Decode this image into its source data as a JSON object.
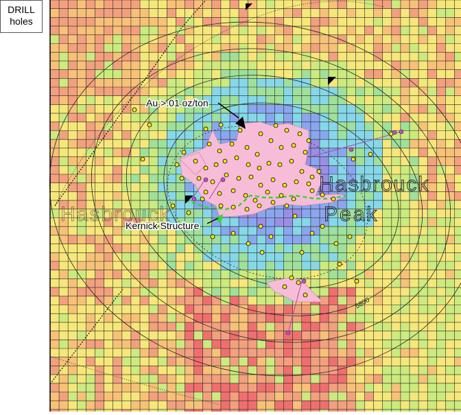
{
  "legend": {
    "line1": "DRILL",
    "line2": "holes"
  },
  "labels": {
    "au_threshold": "Au >.01 oz/ton",
    "kernick": "Kernick Structure",
    "place_name_1": "Hasbrouck",
    "place_name_2": "Peak",
    "place_name_left": "Hasbrouck",
    "contour": "5800"
  },
  "colors": {
    "red": "#ef6f6f",
    "salmon": "#f2a07e",
    "orange": "#f7c178",
    "yellow": "#f6e77a",
    "lime": "#ccea7e",
    "green": "#9fe09a",
    "cyan": "#86d8e8",
    "blue": "#8aa6ee",
    "purple": "#9a8ee6",
    "pink_zone": "#f7bdd8",
    "fault_green": "#3bd13b",
    "drill_hole": "#f2e21a",
    "collar": "#c04ec8"
  },
  "icons": [
    "north-arrow-marker",
    "drill-hole-dot"
  ]
}
